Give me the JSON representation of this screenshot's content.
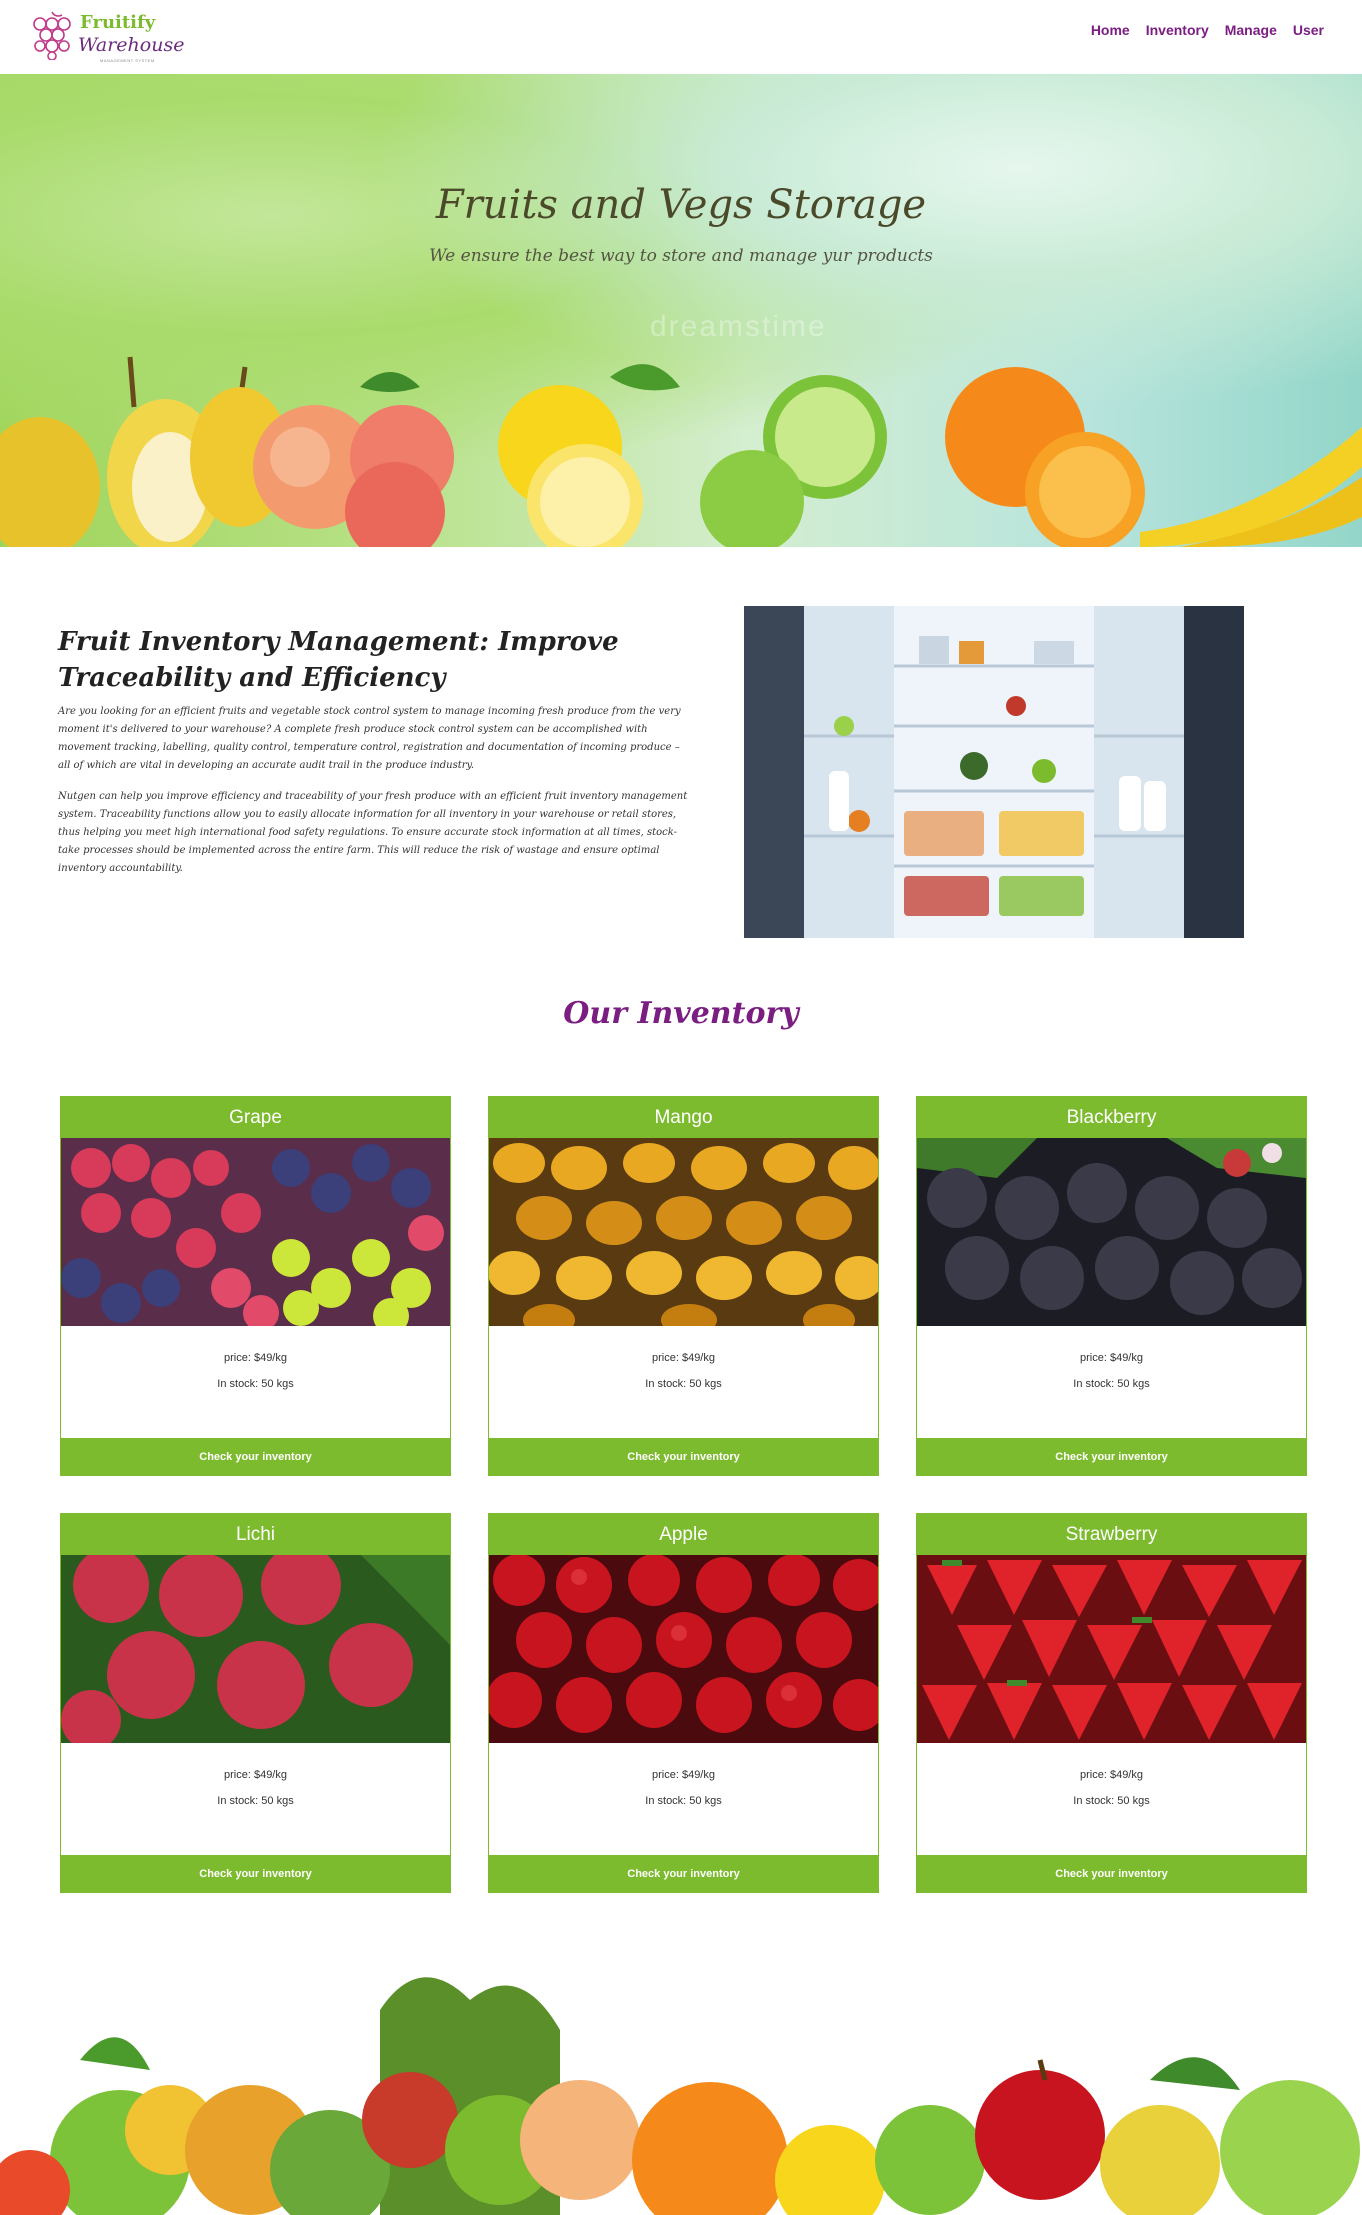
{
  "brand": {
    "name_top": "Fruitify",
    "name_bottom": "Warehouse",
    "tagline": "MANAGEMENT SYSTEM",
    "colors": {
      "green": "#7dbb2e",
      "purple": "#7a1e82"
    }
  },
  "nav": {
    "items": [
      "Home",
      "Inventory",
      "Manage",
      "User"
    ]
  },
  "hero": {
    "title": "Fruits and Vegs Storage",
    "subtitle": "We ensure the best way to store and manage yur products",
    "watermark": "dreamstime"
  },
  "intro": {
    "title": "Fruit Inventory Management: Improve Traceability and Efficiency",
    "paragraph1": "Are you looking for an efficient fruits and vegetable stock control system to manage incoming fresh produce from the very moment it's delivered to your warehouse? A complete fresh produce stock control system can be accomplished with movement tracking, labelling, quality control, temperature control, registration and documentation of incoming produce – all of which are vital in developing an accurate audit trail in the produce industry.",
    "paragraph2": "Nutgen can help you improve efficiency and traceability of your fresh produce with an efficient fruit inventory management system. Traceability functions allow you to easily allocate information for all inventory in your warehouse or retail stores, thus helping you meet high international food safety regulations. To ensure accurate stock information at all times, stock-take processes should be implemented across the entire farm. This will reduce the risk of wastage and ensure optimal inventory accountability."
  },
  "inventory": {
    "title": "Our Inventory",
    "button_label": "Check your inventory",
    "items": [
      {
        "name": "Grape",
        "price": "price: $49/kg",
        "stock": "In stock: 50 kgs"
      },
      {
        "name": "Mango",
        "price": "price: $49/kg",
        "stock": "In stock: 50 kgs"
      },
      {
        "name": "Blackberry",
        "price": "price: $49/kg",
        "stock": "In stock: 50 kgs"
      },
      {
        "name": "Lichi",
        "price": "price: $49/kg",
        "stock": "In stock: 50 kgs"
      },
      {
        "name": "Apple",
        "price": "price: $49/kg",
        "stock": "In stock: 50 kgs"
      },
      {
        "name": "Strawberry",
        "price": "price: $49/kg",
        "stock": "In stock: 50 kgs"
      }
    ]
  }
}
